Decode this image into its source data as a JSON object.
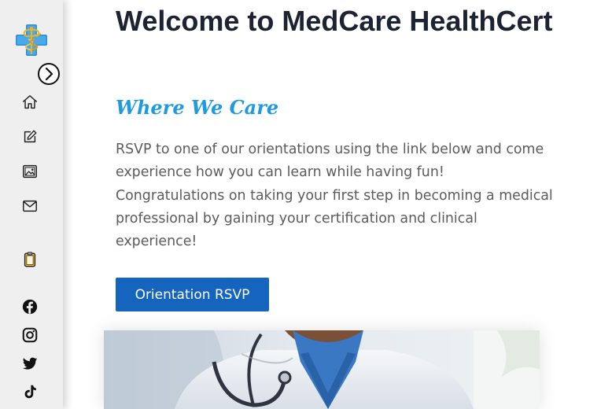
{
  "sidebar": {
    "logo_icon": "medical-cross-caduceus-icon",
    "toggle_icon": "chevron-right-circle-icon",
    "nav": [
      {
        "icon": "home-icon"
      },
      {
        "icon": "edit-icon"
      },
      {
        "icon": "gallery-icon"
      },
      {
        "icon": "mail-icon"
      },
      {
        "icon": "clipboard-icon"
      }
    ],
    "social": [
      {
        "icon": "facebook-icon"
      },
      {
        "icon": "instagram-icon"
      },
      {
        "icon": "twitter-icon"
      },
      {
        "icon": "tiktok-icon"
      }
    ]
  },
  "main": {
    "heading": "Welcome to MedCare HealthCert",
    "tagline": "Where We Care",
    "intro": "RSVP to one of our orientations using the link below and come experience how you can learn while having fun! Congratulations on taking your first step in becoming a medical professional by gaining your certification and clinical experience!",
    "button_label": "Orientation RSVP"
  },
  "colors": {
    "heading": "#1d2333",
    "tagline": "#1e9be0",
    "button": "#1565bf",
    "sidebar_bg": "#efefef",
    "text": "#5b5b5b"
  }
}
